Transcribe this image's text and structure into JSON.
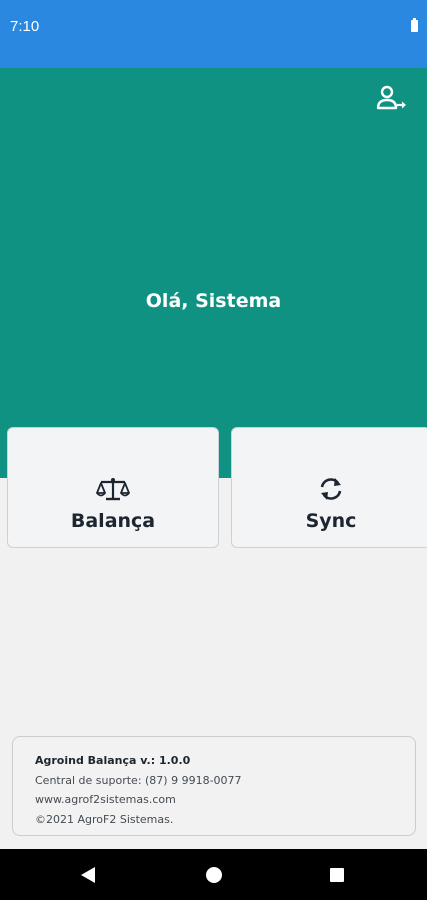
{
  "status_bar": {
    "time": "7:10"
  },
  "header": {
    "greeting": "Olá, Sistema",
    "logout_icon": "user-logout-icon"
  },
  "cards": [
    {
      "label": "Balança",
      "icon": "scale-icon"
    },
    {
      "label": "Sync",
      "icon": "sync-icon"
    }
  ],
  "footer_info": {
    "app_version": "Agroind Balança v.: 1.0.0",
    "support": "Central de suporte: (87) 9 9918-0077",
    "website": "www.agrof2sistemas.com",
    "copyright": "©2021 AgroF2 Sistemas."
  },
  "nav_bar": {
    "back_icon": "back-icon",
    "home_icon": "home-icon",
    "recents_icon": "recents-icon"
  },
  "colors": {
    "status_bar": "#2b88e0",
    "header": "#0f9282",
    "background": "#f1f1f1",
    "card_background": "#f2f4f5",
    "text_dark": "#1c2530"
  }
}
